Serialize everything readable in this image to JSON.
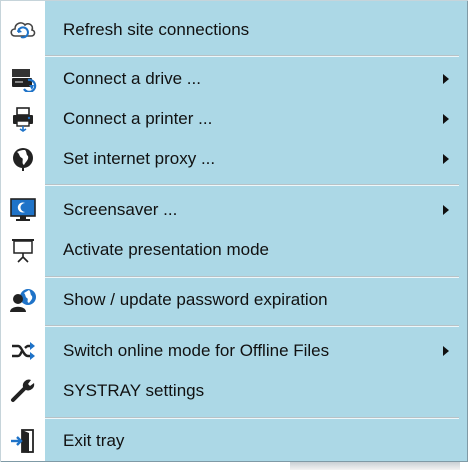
{
  "menu": {
    "items": [
      {
        "label": "Refresh site connections",
        "icon": "cloud-refresh-icon",
        "submenu": false
      },
      {
        "label": "Connect a drive ...",
        "icon": "network-drive-icon",
        "submenu": true
      },
      {
        "label": "Connect a printer ...",
        "icon": "printer-icon",
        "submenu": true
      },
      {
        "label": "Set internet proxy ...",
        "icon": "globe-icon",
        "submenu": true
      },
      {
        "label": "Screensaver ...",
        "icon": "monitor-moon-icon",
        "submenu": true
      },
      {
        "label": "Activate presentation mode",
        "icon": "projector-screen-icon",
        "submenu": false
      },
      {
        "label": "Show / update password expiration",
        "icon": "user-globe-icon",
        "submenu": false
      },
      {
        "label": "Switch online mode for Offline Files",
        "icon": "shuffle-icon",
        "submenu": true
      },
      {
        "label": "SYSTRAY settings",
        "icon": "wrench-icon",
        "submenu": false
      },
      {
        "label": "Exit tray",
        "icon": "exit-door-icon",
        "submenu": false
      }
    ]
  },
  "colors": {
    "background": "#acd8e6",
    "icon_blue": "#1f73c8",
    "icon_dark": "#222222"
  }
}
